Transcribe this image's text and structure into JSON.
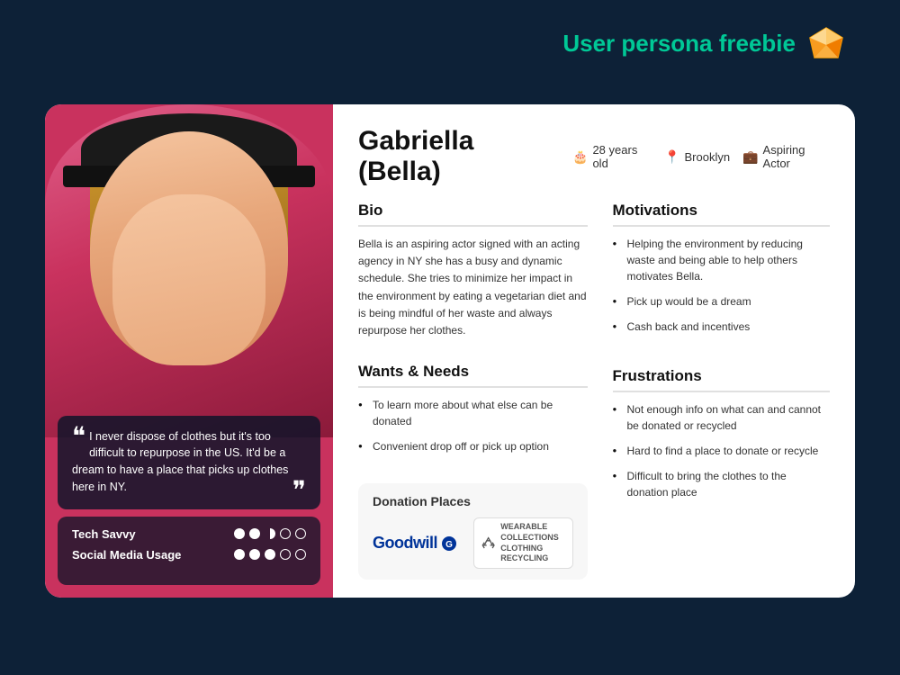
{
  "header": {
    "title": "User persona freebie"
  },
  "persona": {
    "name": "Gabriella (Bella)",
    "age": "28 years old",
    "location": "Brooklyn",
    "occupation": "Aspiring Actor",
    "bio_text": "Bella is an aspiring actor signed with an acting agency in NY she has a busy and dynamic schedule. She tries to minimize her impact in the environment by eating a vegetarian diet and is being mindful of her waste and always repurpose her clothes.",
    "quote": "I never dispose of clothes but it's too difficult to repurpose in the US. It'd be a dream to have a place that picks up clothes here in NY.",
    "skills": [
      {
        "label": "Tech Savvy",
        "dots": [
          "full",
          "full",
          "half",
          "empty",
          "empty"
        ]
      },
      {
        "label": "Social Media Usage",
        "dots": [
          "full",
          "full",
          "full",
          "empty",
          "empty"
        ]
      }
    ],
    "motivations": {
      "title": "Motivations",
      "items": [
        "Helping the environment by reducing waste and being able to help others motivates Bella.",
        "Pick up would be a dream",
        "Cash back and incentives"
      ]
    },
    "wants_needs": {
      "title": "Wants & Needs",
      "items": [
        "To learn more about what else can be donated",
        "Convenient drop off or pick up option"
      ]
    },
    "frustrations": {
      "title": "Frustrations",
      "items": [
        "Not enough info on what can and cannot be donated or recycled",
        "Hard to find a place to donate or recycle",
        "Difficult to bring the clothes to the donation place"
      ]
    },
    "donation": {
      "title": "Donation Places",
      "places": [
        "Goodwill",
        "wearable collections clothing recycling"
      ]
    },
    "bio_title": "Bio",
    "wants_title": "Wants & Needs"
  },
  "icons": {
    "age_icon": "🎂",
    "location_icon": "📍",
    "occupation_icon": "💼",
    "sketch_icon": "◆"
  }
}
